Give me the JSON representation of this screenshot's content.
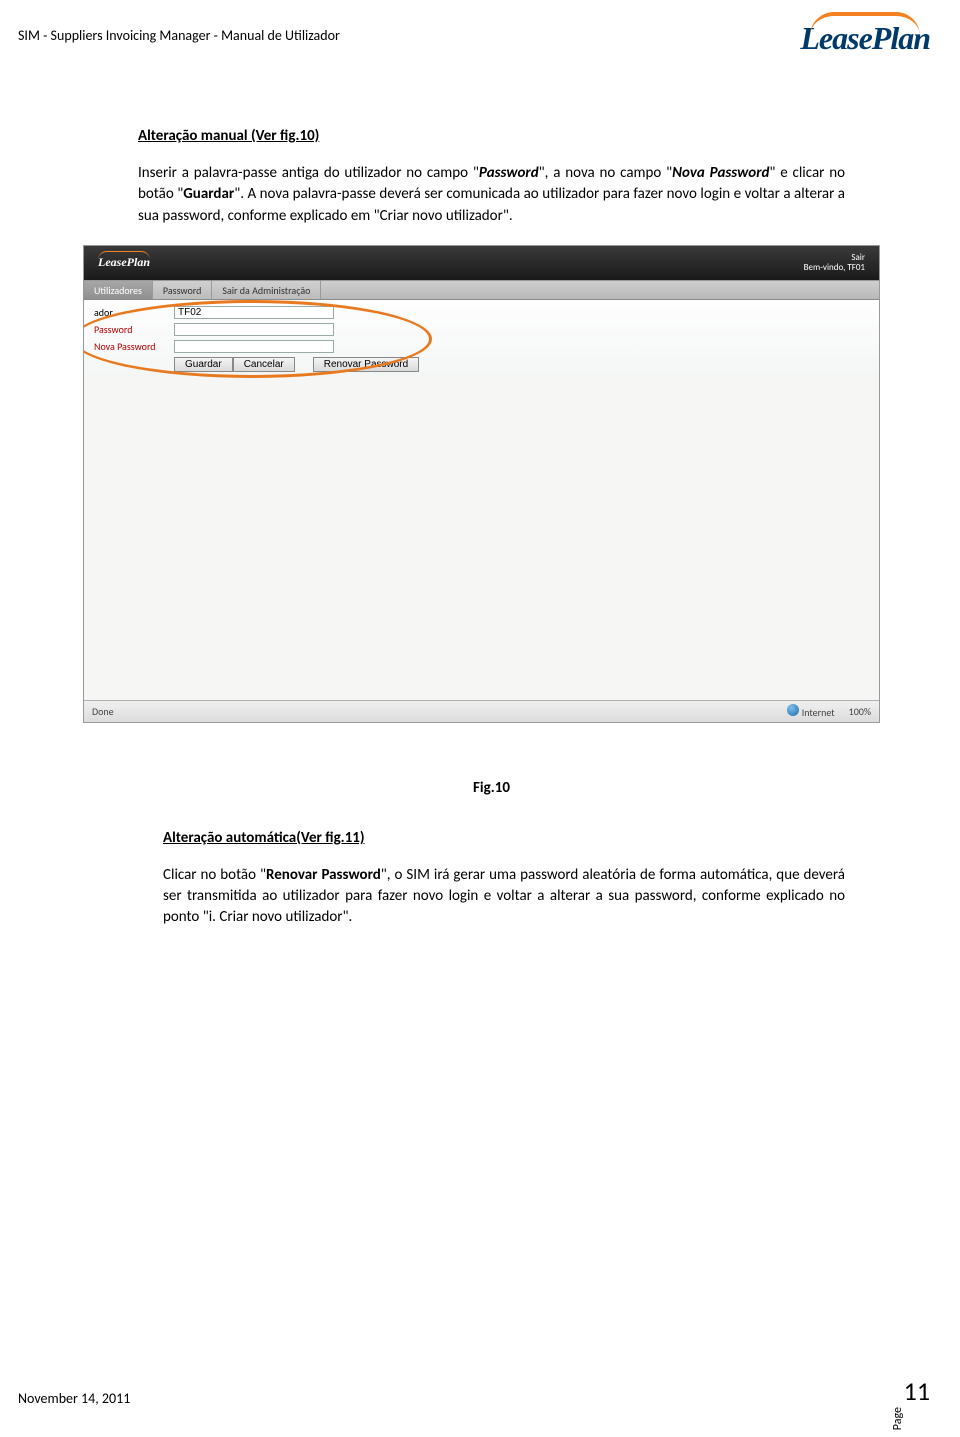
{
  "doc_header": "SIM - Suppliers Invoicing Manager - Manual de Utilizador",
  "logo_text": "LeasePlan",
  "section1": {
    "heading": "Alteração manual (Ver fig.10)",
    "p1_pre": "Inserir a palavra-passe antiga do utilizador no campo \"",
    "p1_bold1": "Password",
    "p1_mid1": "\", a nova no campo \"",
    "p1_bold2": "Nova Password",
    "p1_mid2": "\" e clicar no botão \"",
    "p1_bold3": "Guardar",
    "p1_post": "\". A nova palavra-passe deverá ser comunicada ao utilizador para fazer novo login e voltar a alterar a sua password, conforme explicado em \"Criar novo utilizador\"."
  },
  "screenshot": {
    "topbar_right_line1": "Sair",
    "topbar_right_line2": "Bem-vindo, TF01",
    "tabs": {
      "t1": "Utilizadores",
      "t2": "Password",
      "t3": "Sair da Administração"
    },
    "form": {
      "label_user": "ador",
      "value_user": "TF02",
      "label_pass": "Password",
      "label_newpass": "Nova Password",
      "btn_guardar": "Guardar",
      "btn_cancelar": "Cancelar",
      "btn_renovar": "Renovar Password"
    },
    "status_left": "Done",
    "status_zone": "Internet",
    "status_zoom": "100%"
  },
  "fig_caption": "Fig.10",
  "section2": {
    "heading": "Alteração automática(Ver fig.11)",
    "p_pre": "Clicar no botão \"",
    "p_bold": "Renovar Password",
    "p_post": "\", o SIM irá gerar uma password aleatória de forma automática, que deverá ser transmitida ao utilizador para fazer novo login e voltar a alterar a sua password, conforme explicado no ponto \"i. Criar novo utilizador\"."
  },
  "footer_date": "November 14, 2011",
  "page_label": "Page",
  "page_number": "11"
}
